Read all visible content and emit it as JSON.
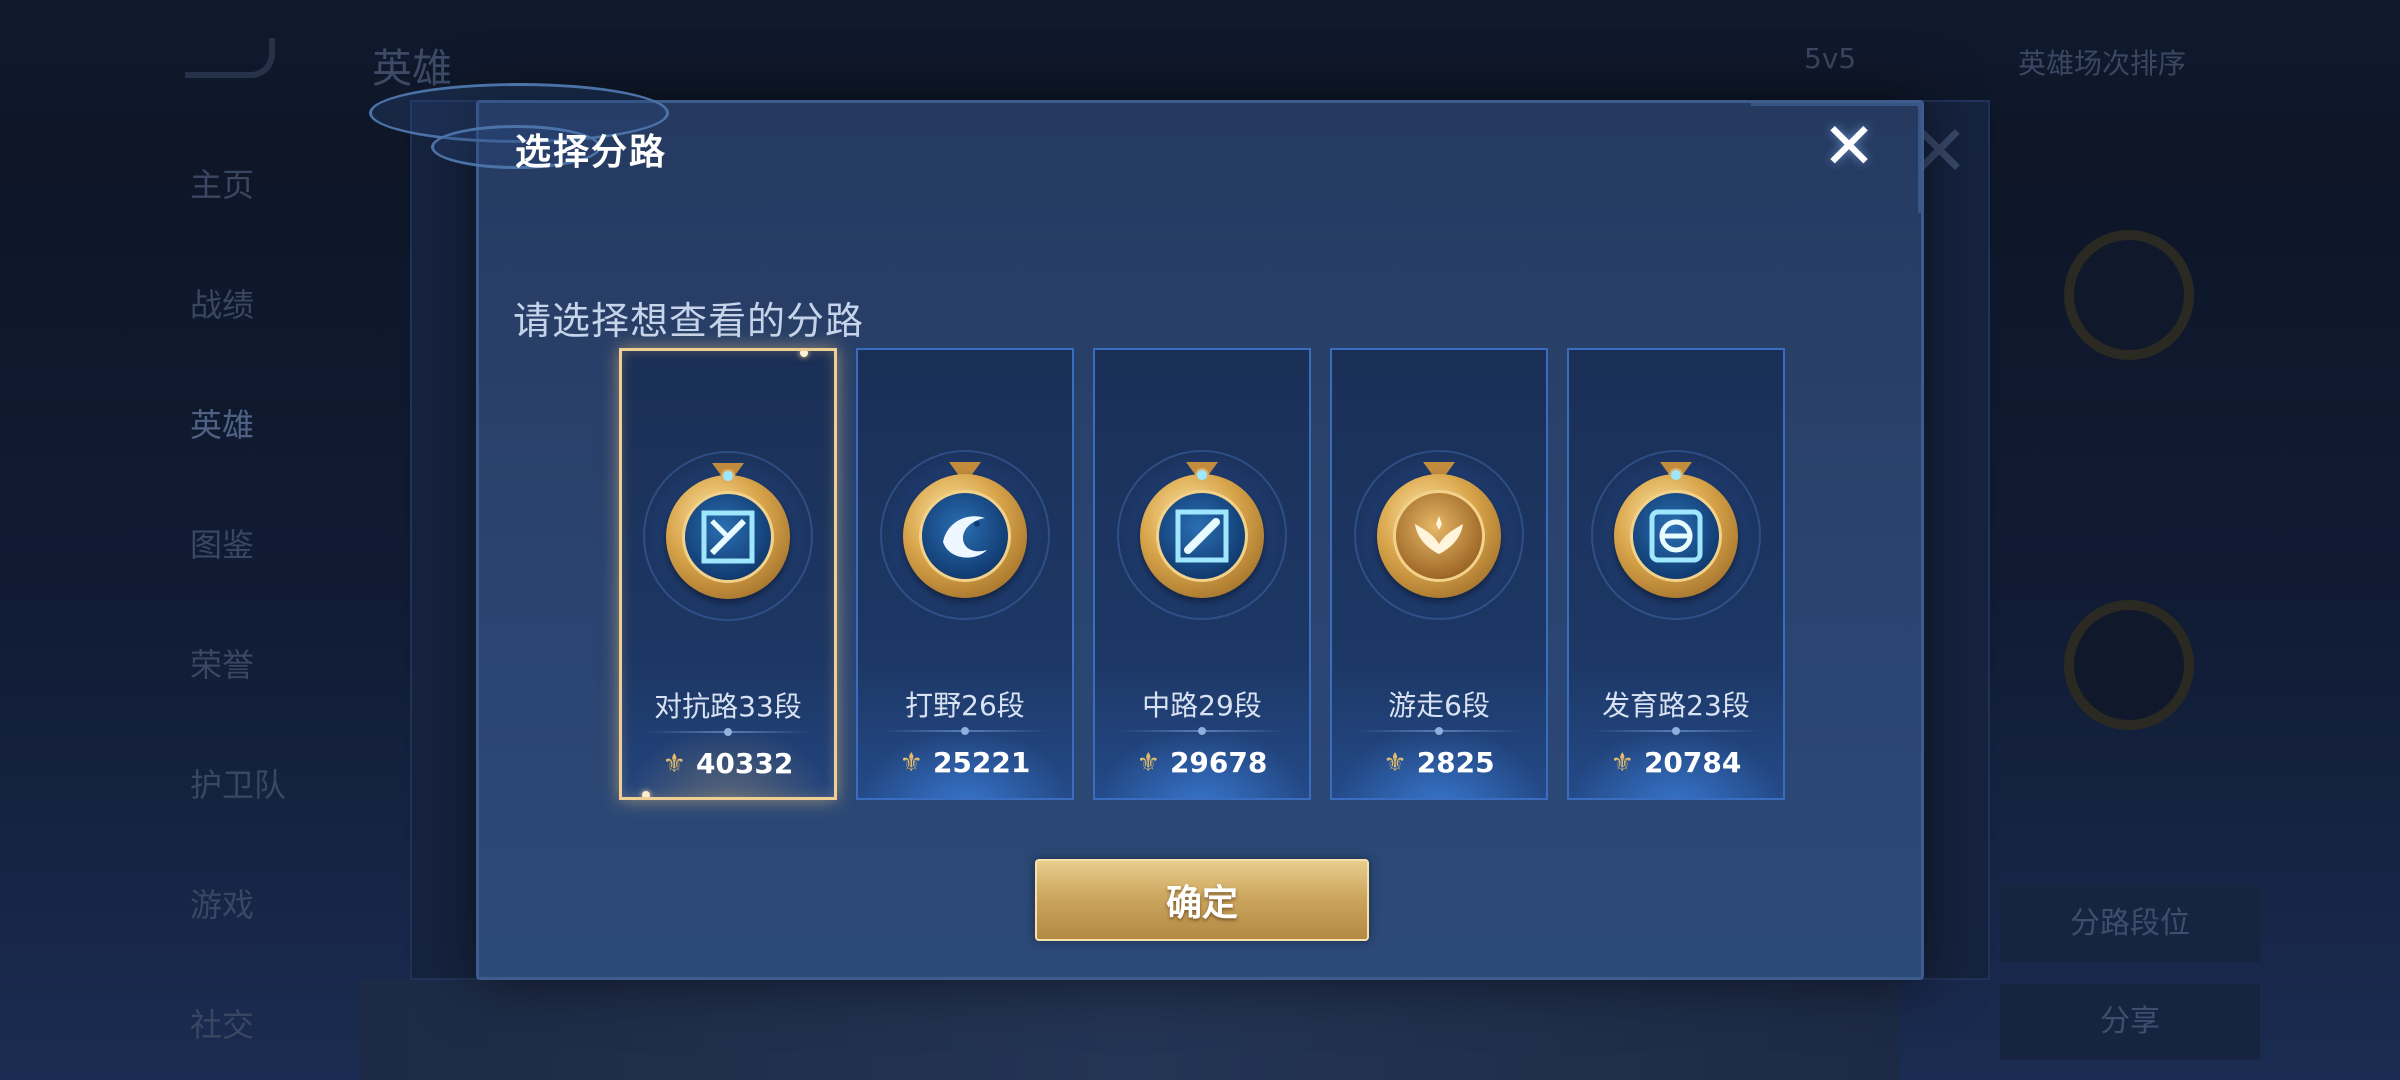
{
  "background": {
    "title": "英雄",
    "subtitle": "",
    "filters": [
      "5v5",
      "英雄场次排序"
    ],
    "sidebar_items": [
      "主页",
      "战绩",
      "英雄",
      "图鉴",
      "荣誉",
      "护卫队",
      "游戏",
      "社交"
    ],
    "right_buttons": [
      "分路段位",
      "分享"
    ]
  },
  "dialog": {
    "title": "选择分路",
    "prompt": "请选择想查看的分路",
    "close_symbol": "✕",
    "confirm_label": "确定",
    "selected_index": 0,
    "cards": [
      {
        "label": "对抗路33段",
        "score": "40332",
        "icon": "sword-cross-icon"
      },
      {
        "label": "打野26段",
        "score": "25221",
        "icon": "dragon-icon"
      },
      {
        "label": "中路29段",
        "score": "29678",
        "icon": "staff-icon"
      },
      {
        "label": "游走6段",
        "score": "2825",
        "icon": "wings-icon"
      },
      {
        "label": "发育路23段",
        "score": "20784",
        "icon": "target-icon"
      }
    ],
    "score_icon": "power-icon"
  },
  "colors": {
    "accent_gold": "#e2bb6d",
    "card_border": "#3a6cc0",
    "selected_border": "#f0cf94"
  }
}
